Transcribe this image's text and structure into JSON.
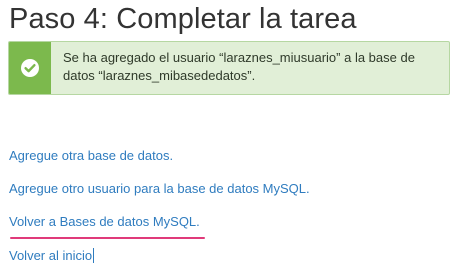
{
  "header": {
    "title": "Paso 4: Completar la tarea"
  },
  "alert": {
    "icon": "check-circle-icon",
    "message": "Se ha agregado el usuario “laraznes_miusuario” a la base de datos “laraznes_mibasededatos”."
  },
  "links": {
    "add_database": "Agregue otra base de datos.",
    "add_user": "Agregue otro usuario para la base de datos MySQL.",
    "back_to_databases": "Volver a Bases de datos MySQL.",
    "back_home": "Volver al inicio"
  },
  "colors": {
    "link": "#2f7cbf",
    "success_icon_bg": "#7cb94d",
    "success_bg": "#e1efd7",
    "highlight_underline": "#e03a7a"
  }
}
